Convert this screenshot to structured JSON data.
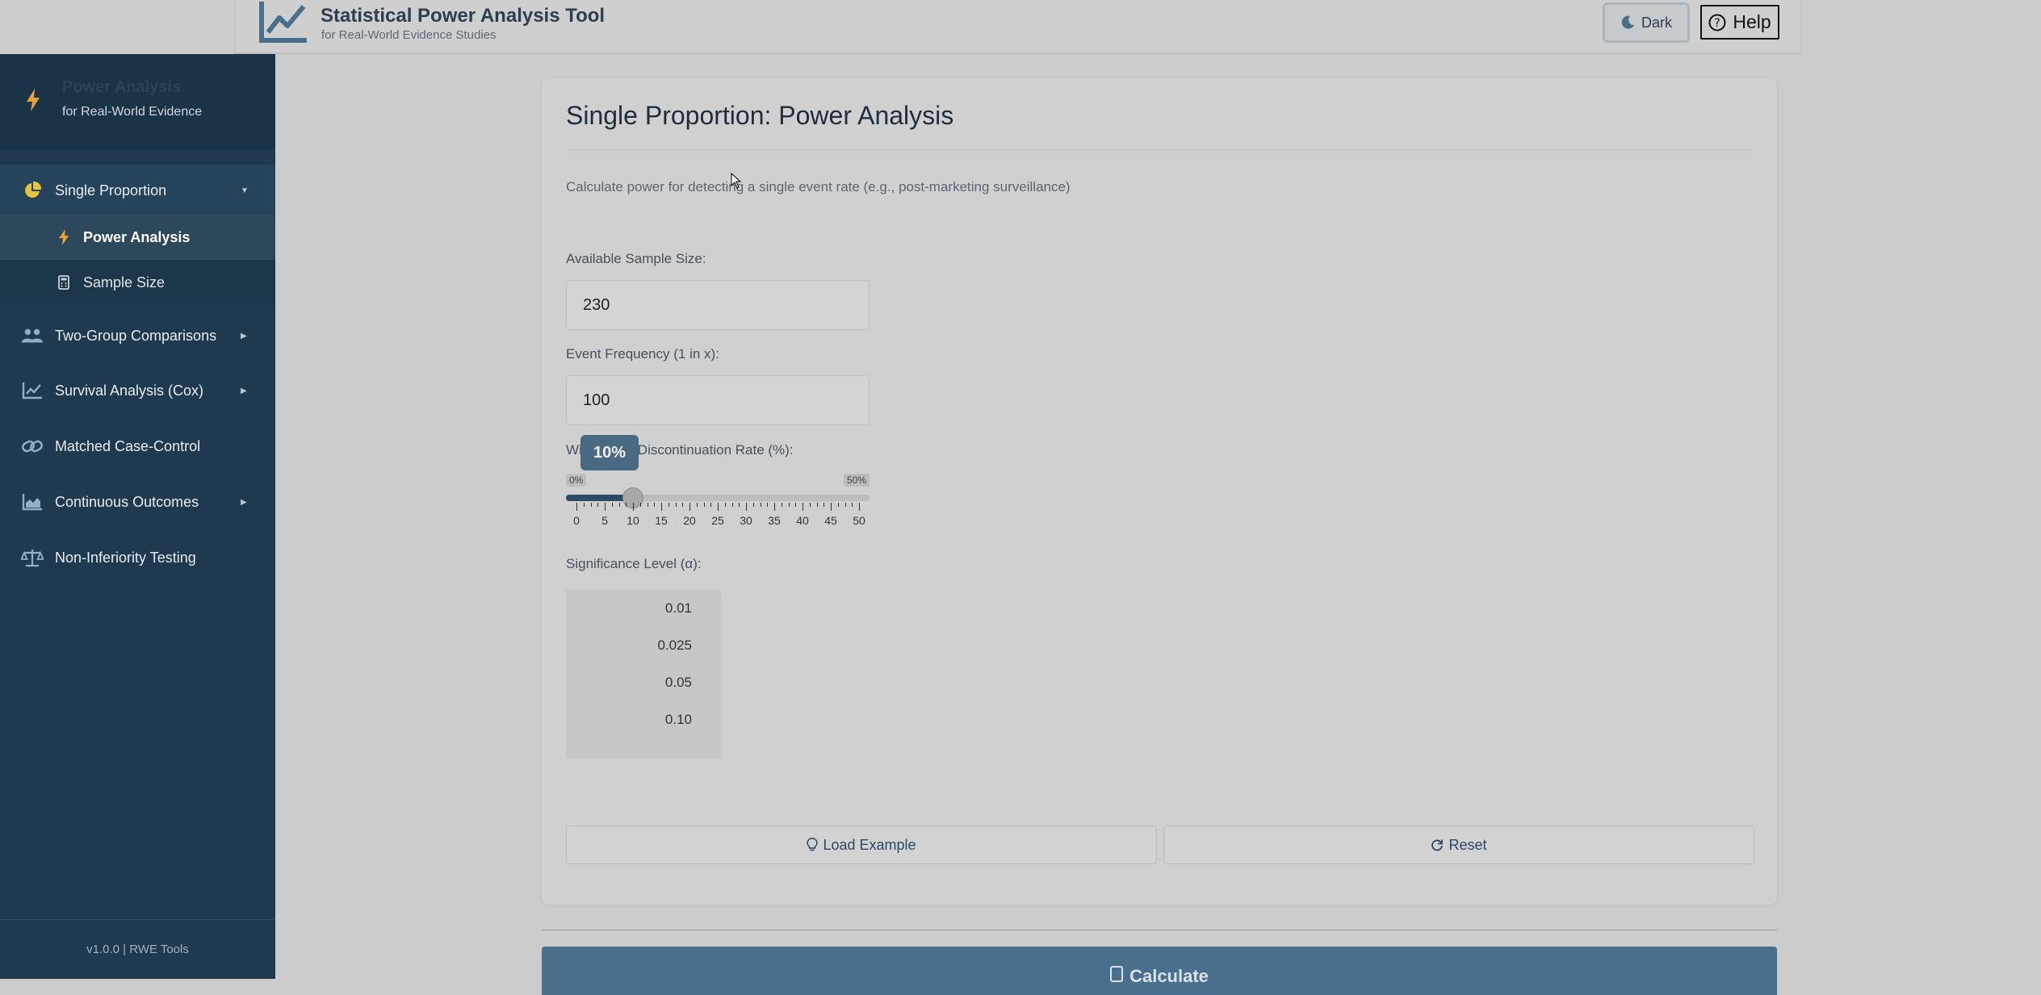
{
  "header": {
    "title": "Statistical Power Analysis Tool",
    "subtitle": "for Real-World Evidence Studies",
    "theme_button": "Dark",
    "help_button": "Help"
  },
  "sidebar": {
    "brand_title": "Power Analysis",
    "brand_subtitle": "for Real-World Evidence",
    "items": [
      {
        "label": "Single Proportion",
        "icon": "pie-chart-icon"
      },
      {
        "label": "Two-Group Comparisons",
        "icon": "users-icon"
      },
      {
        "label": "Survival Analysis (Cox)",
        "icon": "line-chart-icon"
      },
      {
        "label": "Matched Case-Control",
        "icon": "link-icon"
      },
      {
        "label": "Continuous Outcomes",
        "icon": "area-chart-icon"
      },
      {
        "label": "Non-Inferiority Testing",
        "icon": "balance-scale-icon"
      }
    ],
    "subitems": [
      {
        "label": "Power Analysis",
        "icon": "bolt-icon",
        "active": true
      },
      {
        "label": "Sample Size",
        "icon": "calculator-icon",
        "active": false
      }
    ],
    "footer": "v1.0.0 | RWE Tools"
  },
  "main": {
    "title": "Single Proportion: Power Analysis",
    "description": "Calculate power for detecting a single event rate (e.g., post-marketing surveillance)",
    "sample_size_label": "Available Sample Size:",
    "sample_size_value": "230",
    "event_freq_label": "Event Frequency (1 in x):",
    "event_freq_value": "100",
    "withdrawal_label": "Withdrawal/Discontinuation Rate (%):",
    "withdrawal": {
      "value": 10,
      "min": 0,
      "max": 50,
      "tooltip": "10%",
      "min_label": "0%",
      "max_label": "50%",
      "ticks": [
        "0",
        "5",
        "10",
        "15",
        "20",
        "25",
        "30",
        "35",
        "40",
        "45",
        "50"
      ]
    },
    "alpha_label": "Significance Level (α):",
    "alpha_options": [
      "0.01",
      "0.025",
      "0.05",
      "0.10"
    ],
    "load_example": "Load Example",
    "reset": "Reset",
    "calculate": "Calculate"
  },
  "colors": {
    "sidebar_bg": "#1f3a4f",
    "accent": "#2c4a63",
    "bolt": "#e9a23b"
  }
}
